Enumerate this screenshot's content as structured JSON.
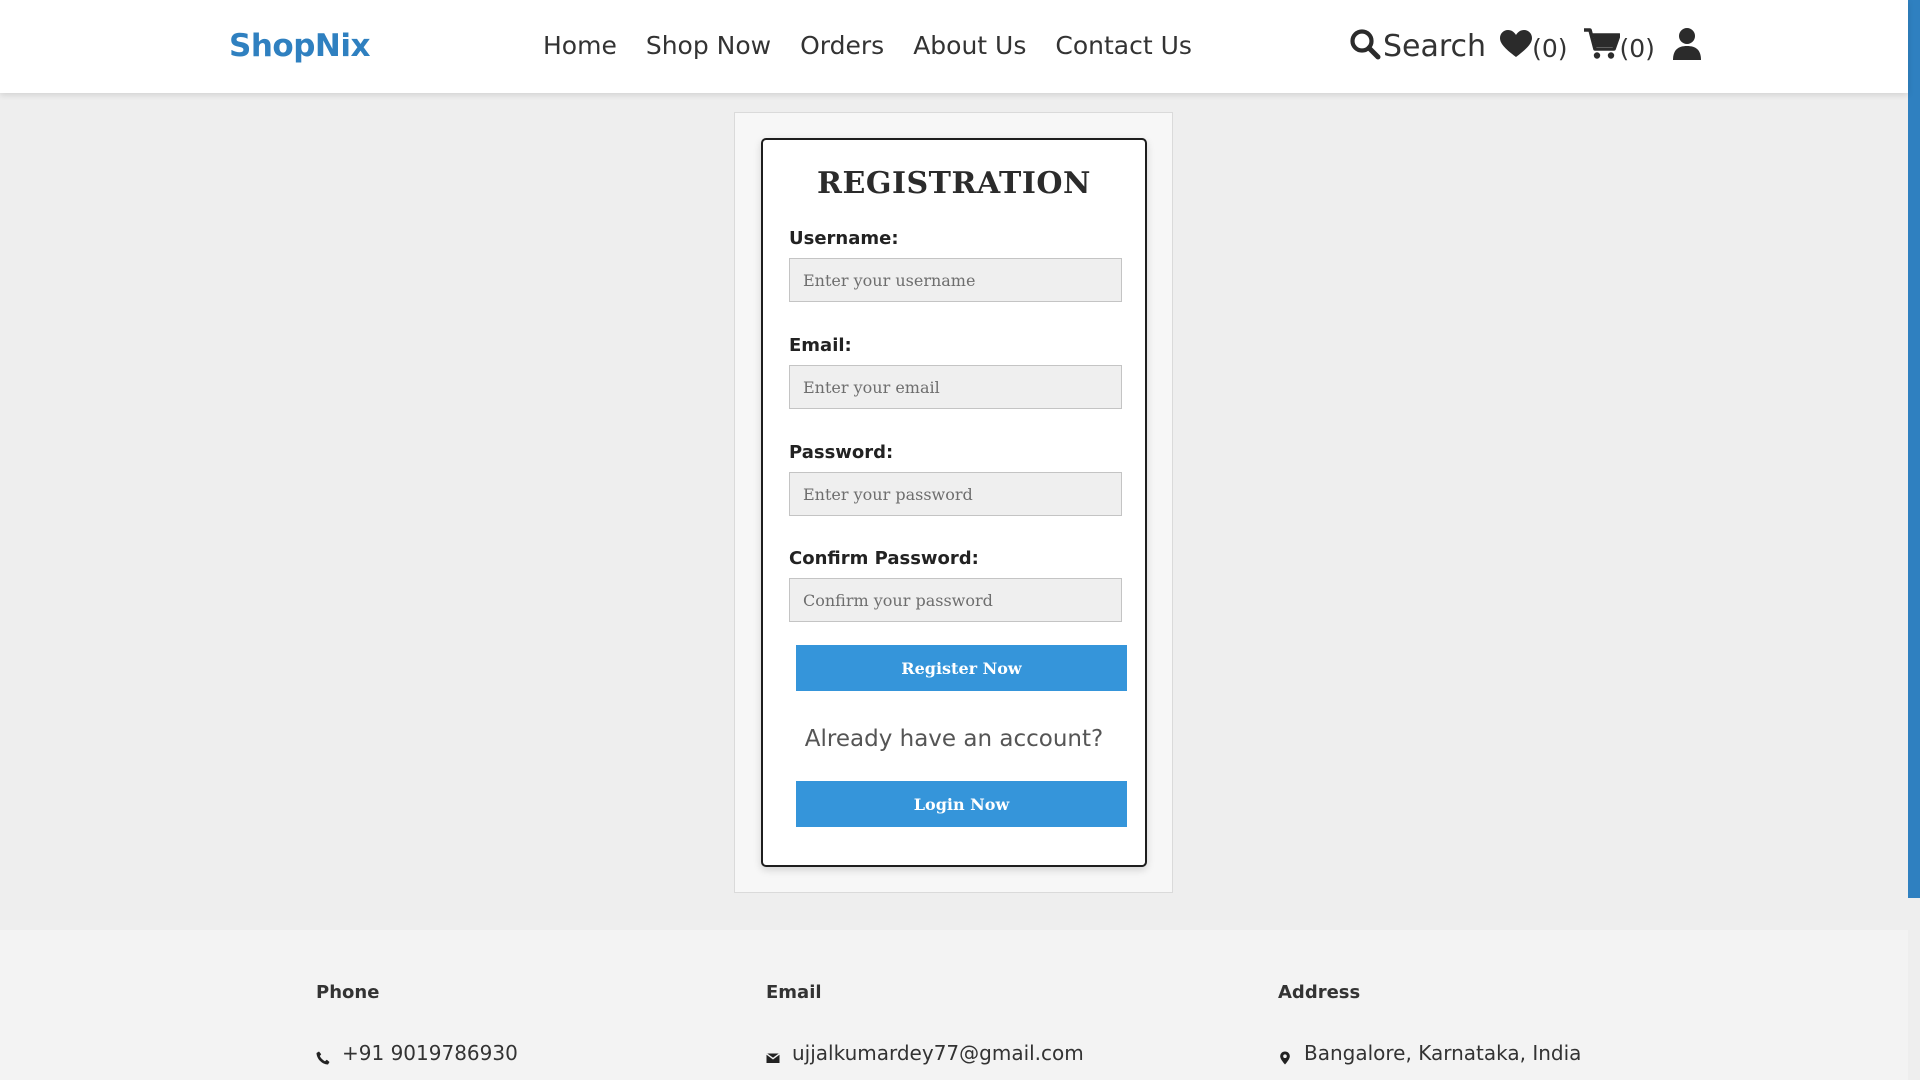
{
  "brand": {
    "name": "ShopNix",
    "color": "#2f80c0"
  },
  "nav": {
    "links": [
      "Home",
      "Shop Now",
      "Orders",
      "About Us",
      "Contact Us"
    ],
    "search_label": "Search",
    "wishlist_count": "(0)",
    "cart_count": "(0)",
    "icons": [
      "search-icon",
      "heart-icon",
      "cart-icon",
      "user-icon"
    ]
  },
  "form": {
    "title": "REGISTRATION",
    "fields": [
      {
        "label": "Username:",
        "placeholder": "Enter your username",
        "value": ""
      },
      {
        "label": "Email:",
        "placeholder": "Enter your email",
        "value": ""
      },
      {
        "label": "Password:",
        "placeholder": "Enter your password",
        "value": ""
      },
      {
        "label": "Confirm Password:",
        "placeholder": "Confirm your password",
        "value": ""
      }
    ],
    "register_label": "Register Now",
    "account_prompt": "Already have an account?",
    "login_label": "Login Now",
    "button_color": "#3595da"
  },
  "footer": {
    "phone": {
      "heading": "Phone",
      "value": "+91 9019786930",
      "icon": "phone-icon"
    },
    "email": {
      "heading": "Email",
      "value": "ujjalkumardey77@gmail.com",
      "icon": "mail-icon"
    },
    "address": {
      "heading": "Address",
      "value": "Bangalore, Karnataka, India",
      "icon": "location-pin-icon"
    }
  }
}
